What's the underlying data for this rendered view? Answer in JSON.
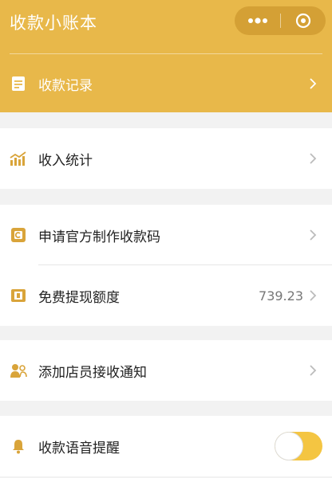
{
  "app": {
    "title": "收款小账本"
  },
  "colors": {
    "accent": "#e8b84a",
    "icon": "#d9a43a",
    "background": "#f2f2f2"
  },
  "header_item": {
    "label": "收款记录",
    "icon": "document-icon"
  },
  "menu": [
    {
      "label": "收入统计",
      "icon": "bar-chart-icon"
    },
    {
      "label": "申请官方制作收款码",
      "icon": "qrcode-card-icon"
    },
    {
      "label": "免费提现额度",
      "icon": "receipt-icon",
      "value": "739.23"
    },
    {
      "label": "添加店员接收通知",
      "icon": "staff-icon"
    },
    {
      "label": "收款语音提醒",
      "icon": "bell-icon"
    }
  ]
}
